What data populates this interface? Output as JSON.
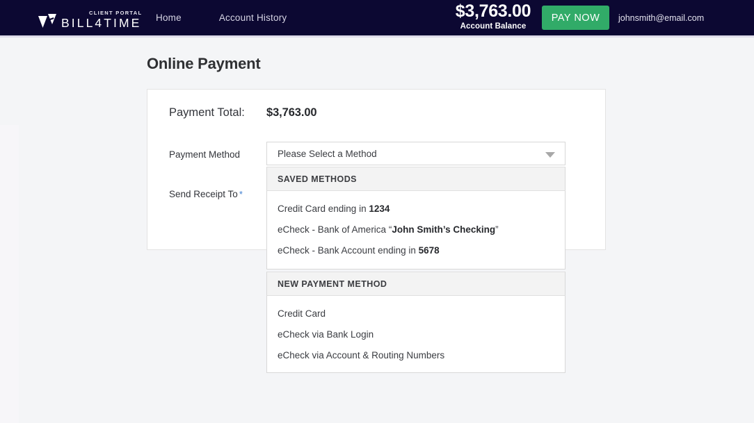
{
  "header": {
    "logo": {
      "mark_icon": "bill4time-arrow-logo-icon",
      "kicker": "CLIENT PORTAL",
      "wordmark": "BILL4TIME"
    },
    "nav": [
      {
        "label": "Home"
      },
      {
        "label": "Account History"
      }
    ],
    "balance": {
      "amount": "$3,763.00",
      "label": "Account Balance"
    },
    "pay_now_label": "PAY NOW",
    "user_email": "johnsmith@email.com",
    "colors": {
      "background": "#0c0832",
      "pay_now": "#31ab68",
      "nav_link": "#d6d4e4"
    }
  },
  "page": {
    "title": "Online Payment"
  },
  "form": {
    "payment_total": {
      "label": "Payment Total:",
      "value": "$3,763.00"
    },
    "payment_method": {
      "label": "Payment Method",
      "selected_value": "Please Select a Method",
      "caret_icon": "chevron-down-icon"
    },
    "send_receipt_to": {
      "label": "Send Receipt To",
      "required_marker": "*",
      "required_color": "#3f7fd0"
    }
  },
  "dropdown": {
    "sections": [
      {
        "header": "SAVED METHODS",
        "items": [
          {
            "prefix": "Credit Card ending in ",
            "strong": "1234",
            "suffix": ""
          },
          {
            "prefix": "eCheck - Bank of America “",
            "strong": "John Smith’s Checking",
            "suffix": "”"
          },
          {
            "prefix": "eCheck - Bank Account ending in ",
            "strong": "5678",
            "suffix": ""
          }
        ]
      },
      {
        "header": "NEW PAYMENT METHOD",
        "items": [
          {
            "prefix": "Credit Card",
            "strong": "",
            "suffix": ""
          },
          {
            "prefix": "eCheck via Bank Login",
            "strong": "",
            "suffix": ""
          },
          {
            "prefix": "eCheck via Account & Routing Numbers",
            "strong": "",
            "suffix": ""
          }
        ]
      }
    ]
  }
}
